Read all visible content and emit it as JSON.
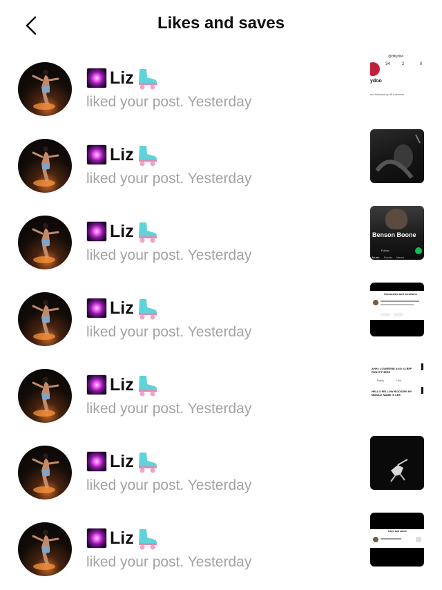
{
  "header": {
    "title": "Likes and saves",
    "back_icon": "chevron-left-icon"
  },
  "notifications": [
    {
      "user": "Liz",
      "action": "liked your post.",
      "time": "Yesterday",
      "thumb": "profile"
    },
    {
      "user": "Liz",
      "action": "liked your post.",
      "time": "Yesterday",
      "thumb": "dark-photo"
    },
    {
      "user": "Liz",
      "action": "liked your post.",
      "time": "Yesterday",
      "thumb": "artist"
    },
    {
      "user": "Liz",
      "action": "liked your post.",
      "time": "Yesterday",
      "thumb": "comments"
    },
    {
      "user": "Liz",
      "action": "liked your post.",
      "time": "Yesterday",
      "thumb": "replies"
    },
    {
      "user": "Liz",
      "action": "liked your post.",
      "time": "Yesterday",
      "thumb": "dancer"
    },
    {
      "user": "Liz",
      "action": "liked your post.",
      "time": "Yesterday",
      "thumb": "likes-screen"
    }
  ],
  "thumbs": {
    "profile": {
      "handle": "@ditlydoo",
      "stats": [
        "34",
        "2",
        "0"
      ],
      "name": "ydoo",
      "bio": "not followed by 85 followers"
    },
    "artist": {
      "artist_name": "Benson Boone",
      "follow_label": "Follow",
      "tabs": [
        "Music",
        "Events",
        "Merch"
      ]
    },
    "comments": {
      "heading": "Comments and mentions"
    },
    "replies": {
      "line1": "AHH I LOVEEERE AGO <3 BFF",
      "line2": "RIGHT THERE",
      "line3": "HELLO FELLOW ROCKER! MY",
      "line4": "MIDDLE NAME IS LEE",
      "reply_label": "Reply",
      "like_label": "Like"
    },
    "likes-screen": {
      "heading": "Likes and saves"
    }
  },
  "colors": {
    "muted_text": "#a3a3a3",
    "accent_green": "#1db954"
  }
}
